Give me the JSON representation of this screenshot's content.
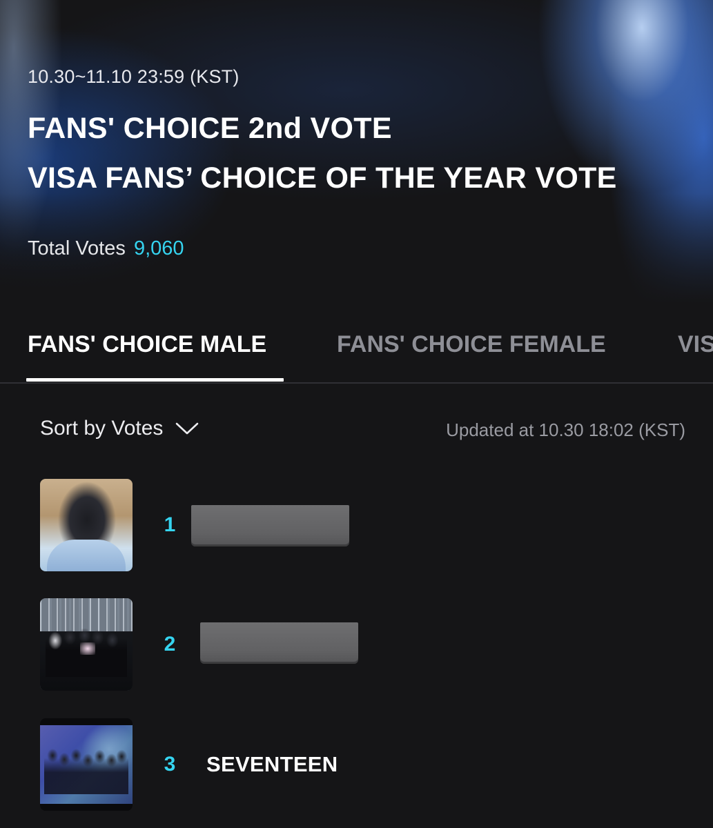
{
  "header": {
    "date_range": "10.30~11.10 23:59 (KST)",
    "title_line1": "FANS' CHOICE 2nd VOTE",
    "title_line2": "VISA FANS’ CHOICE OF THE YEAR VOTE",
    "total_votes_label": "Total Votes",
    "total_votes_value": "9,060"
  },
  "tabs": [
    {
      "label": "FANS' CHOICE MALE",
      "active": true
    },
    {
      "label": "FANS' CHOICE FEMALE",
      "active": false
    },
    {
      "label": "VIS",
      "active": false
    }
  ],
  "sort": {
    "label": "Sort by Votes",
    "icon": "chevron-down-icon"
  },
  "updated_text": "Updated at 10.30 18:02 (KST)",
  "ranking": [
    {
      "rank": "1",
      "name": "",
      "name_redacted": true
    },
    {
      "rank": "2",
      "name": "",
      "name_redacted": true
    },
    {
      "rank": "3",
      "name": "SEVENTEEN",
      "name_redacted": false
    }
  ],
  "colors": {
    "background": "#151517",
    "accent": "#35d4f0",
    "tab_inactive": "#8e8f96",
    "redaction": "#666668"
  }
}
